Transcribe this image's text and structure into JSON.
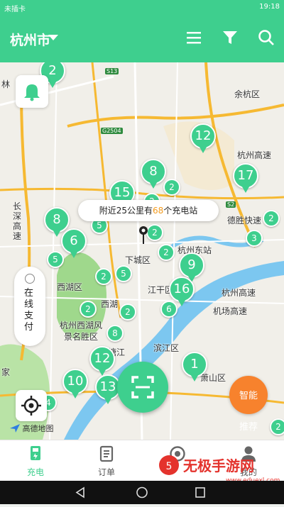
{
  "status_bar": {
    "carrier": "未插卡",
    "time": "19:18"
  },
  "header": {
    "city": "杭州市",
    "icons": [
      "list-icon",
      "filter-icon",
      "search-icon"
    ]
  },
  "map": {
    "bubble": {
      "prefix": "附近25公里有",
      "count": "68",
      "suffix": "个充电站"
    },
    "places": {
      "yuhang": "余杭区",
      "hangzhou_gaosu_1": "杭州高速",
      "changshen": "长深高速",
      "desheng": "德胜快速",
      "xiacheng": "下城区",
      "hangzhoudong": "杭州东站",
      "xihu_district": "西湖区",
      "xihu": "西湖",
      "jianggan": "江干区",
      "hangzhou_gaosu_2": "杭州高速",
      "xihu_scenic_1": "杭州西湖风",
      "xihu_scenic_2": "景名胜区",
      "airport": "机场高速",
      "qiantang": "钱塘江",
      "binjiang": "滨江区",
      "xiaoshan": "萧山区",
      "jia": "家",
      "lin": "林"
    },
    "shields": [
      "S13",
      "G2504",
      "S2"
    ],
    "pins": [
      "2",
      "12",
      "8",
      "17",
      "15",
      "2",
      "2",
      "8",
      "6",
      "2",
      "5",
      "2",
      "3",
      "2",
      "5",
      "9",
      "5",
      "2",
      "16",
      "2",
      "2",
      "6",
      "8",
      "12",
      "10",
      "13",
      "1",
      "4",
      "2"
    ],
    "logo": "高德地图",
    "pay_button": "在线支付",
    "smart_button": [
      "智能",
      "推荐"
    ]
  },
  "tabs": [
    {
      "label": "充电",
      "icon": "charger-icon",
      "active": true
    },
    {
      "label": "订单",
      "icon": "order-icon",
      "active": false
    },
    {
      "label": "",
      "icon": "discover-icon",
      "active": false
    },
    {
      "label": "我的",
      "icon": "person-icon",
      "active": false
    }
  ],
  "watermark": {
    "text": "无极手游网",
    "url": "www.eduexl.com"
  },
  "colors": {
    "primary": "#3ecf8e",
    "accent": "#f39b1f",
    "smart": "#f7822d"
  }
}
